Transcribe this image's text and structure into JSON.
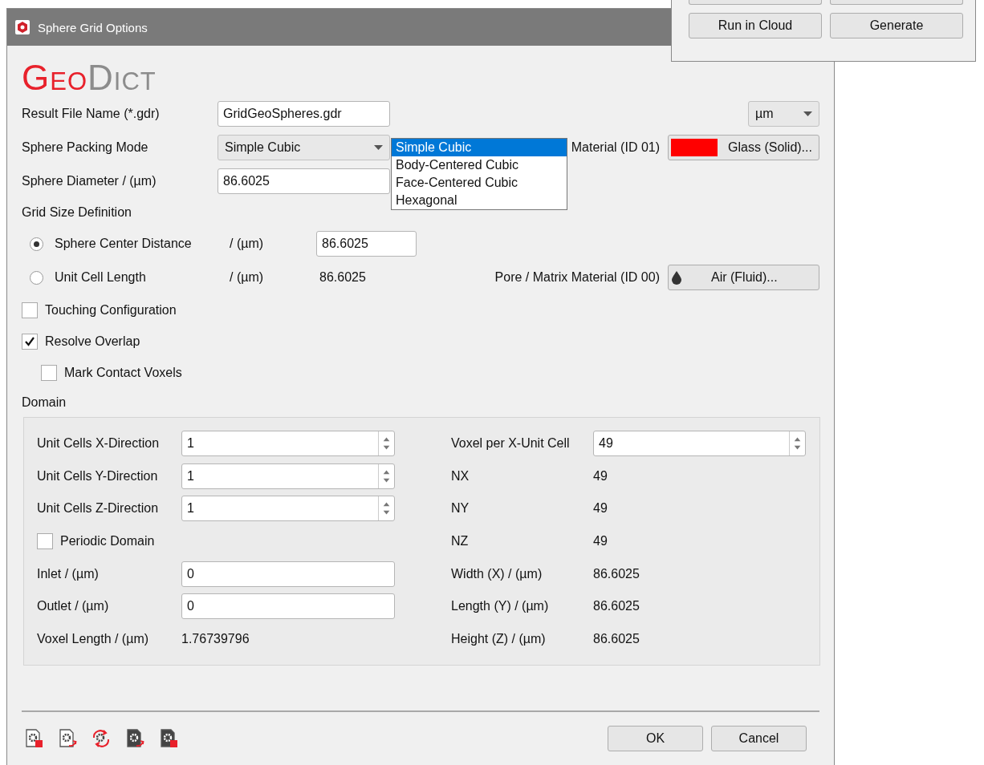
{
  "window": {
    "title": "Sphere Grid Options"
  },
  "background_window": {
    "buttons": [
      {
        "label": "Run in Cloud"
      },
      {
        "label": "Generate"
      }
    ]
  },
  "logo": {
    "first": "Geo",
    "second": "Dict"
  },
  "result_file": {
    "label": "Result File Name (*.gdr)",
    "value": "GridGeoSpheres.gdr"
  },
  "unit_select": {
    "value": "µm"
  },
  "packing_mode": {
    "label": "Sphere Packing Mode",
    "value": "Simple Cubic",
    "options": [
      {
        "label": "Simple Cubic",
        "selected": true
      },
      {
        "label": "Body-Centered Cubic",
        "selected": false
      },
      {
        "label": "Face-Centered Cubic",
        "selected": false
      },
      {
        "label": "Hexagonal",
        "selected": false
      }
    ]
  },
  "sphere_material": {
    "label": "Material (ID 01)",
    "value": "Glass (Solid)...",
    "color": "#ff0000"
  },
  "sphere_diameter": {
    "label": "Sphere Diameter / (µm)",
    "value": "86.6025"
  },
  "grid_size": {
    "title": "Grid Size Definition",
    "options": [
      {
        "label": "Sphere Center Distance",
        "unit": "/ (µm)",
        "value": "86.6025",
        "selected": true
      },
      {
        "label": "Unit Cell Length",
        "unit": "/ (µm)",
        "value": "86.6025",
        "selected": false
      }
    ]
  },
  "pore_material": {
    "label": "Pore / Matrix Material (ID 00)",
    "value": "Air (Fluid)..."
  },
  "checkboxes": [
    {
      "label": "Touching Configuration",
      "checked": false
    },
    {
      "label": "Resolve Overlap",
      "checked": true,
      "children": [
        {
          "label": "Mark Contact Voxels",
          "checked": false
        }
      ]
    }
  ],
  "domain": {
    "title": "Domain",
    "left": [
      {
        "kind": "spin",
        "label": "Unit Cells X-Direction",
        "value": "1"
      },
      {
        "kind": "spin",
        "label": "Unit Cells Y-Direction",
        "value": "1"
      },
      {
        "kind": "spin",
        "label": "Unit Cells Z-Direction",
        "value": "1"
      },
      {
        "kind": "checkbox",
        "label": "Periodic Domain",
        "checked": false
      },
      {
        "kind": "input",
        "label": "Inlet / (µm)",
        "value": "0"
      },
      {
        "kind": "input",
        "label": "Outlet / (µm)",
        "value": "0"
      },
      {
        "kind": "text",
        "label": "Voxel Length / (µm)",
        "value": "1.76739796"
      }
    ],
    "right": [
      {
        "kind": "spin",
        "label": "Voxel per X-Unit Cell",
        "value": "49"
      },
      {
        "kind": "text",
        "label": "NX",
        "value": "49"
      },
      {
        "kind": "text",
        "label": "NY",
        "value": "49"
      },
      {
        "kind": "text",
        "label": "NZ",
        "value": "49"
      },
      {
        "kind": "text",
        "label": "Width (X) / (µm)",
        "value": "86.6025"
      },
      {
        "kind": "text",
        "label": "Length (Y) / (µm)",
        "value": "86.6025"
      },
      {
        "kind": "text",
        "label": "Height (Z) / (µm)",
        "value": "86.6025"
      }
    ]
  },
  "buttons": [
    {
      "label": "OK"
    },
    {
      "label": "Cancel"
    }
  ]
}
